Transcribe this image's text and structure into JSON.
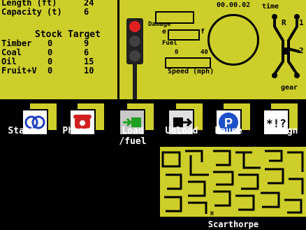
{
  "info": {
    "length_label": "Length (ft)",
    "length_value": "24",
    "capacity_label": "Capacity (t)",
    "capacity_value": "6",
    "stock_header": "Stock Target",
    "cargo": [
      {
        "name": "Timber",
        "stock": "0",
        "target": "9"
      },
      {
        "name": "Coal",
        "stock": "0",
        "target": "6"
      },
      {
        "name": "Oil",
        "stock": "0",
        "target": "15"
      },
      {
        "name": "Fruit+V",
        "stock": "0",
        "target": "10"
      }
    ]
  },
  "gauges": {
    "damage_label": "Damage",
    "fuel_label": "Fuel",
    "fuel_e": "e",
    "fuel_f": "f",
    "speed_min": "0",
    "speed_max": "40",
    "speed_label": "Speed (mph)",
    "time_value": "00.00.02",
    "time_label": "time",
    "gear_r": "R",
    "gear_1": "1",
    "gear_2": "2",
    "gear_label": "gear"
  },
  "menu": [
    {
      "label": "Start",
      "icon": "start-icon"
    },
    {
      "label": "Phone",
      "icon": "phone-icon"
    },
    {
      "label": "Load\n/fuel",
      "icon": "load-fuel-icon"
    },
    {
      "label": "Unload",
      "icon": "unload-icon"
    },
    {
      "label": "Pause",
      "icon": "pause-icon"
    },
    {
      "label": "Resign",
      "icon": "resign-icon"
    }
  ],
  "map": {
    "station_name": "Scarthorpe",
    "marker": "H"
  },
  "colors": {
    "panel": "#CECE2A",
    "background": "#000000",
    "accent_blue": "#1E50C8",
    "accent_red": "#D02020",
    "accent_green": "#20A020"
  }
}
